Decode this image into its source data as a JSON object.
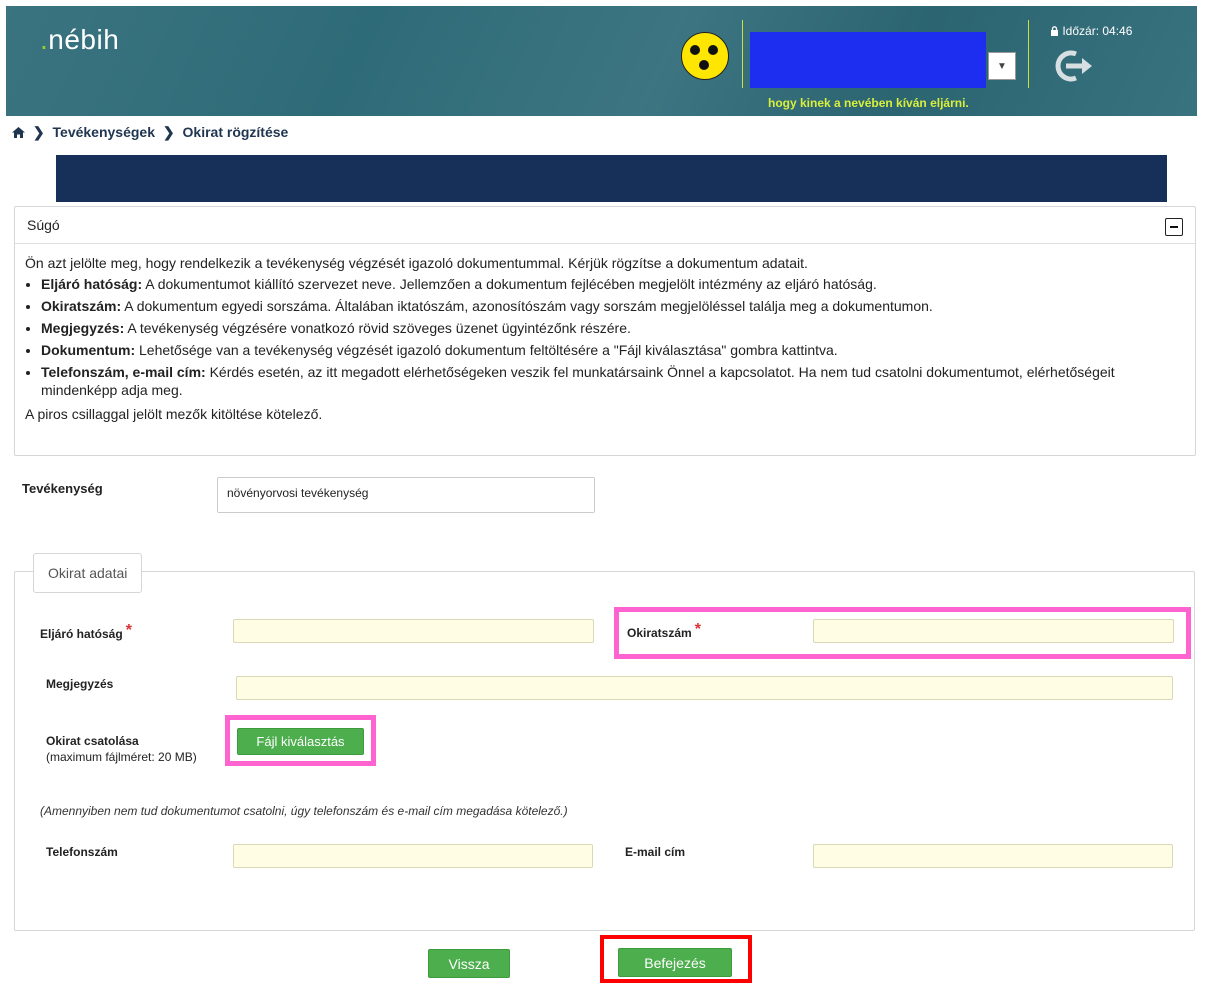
{
  "header": {
    "logo_dot": ".",
    "logo_text": "nébih",
    "rep_note": "hogy kinek a nevében kíván eljárni.",
    "timer_label": "Időzár: 04:46",
    "lock_icon": "lock-icon",
    "logout_icon": "logout-icon"
  },
  "breadcrumb": {
    "home_icon": "home-icon",
    "items": [
      "Tevékenységek",
      "Okirat rögzítése"
    ]
  },
  "help": {
    "title": "Súgó",
    "intro": "Ön azt jelölte meg, hogy rendelkezik a tevékenység végzését igazoló dokumentummal. Kérjük rögzítse a dokumentum adatait.",
    "items": [
      {
        "term": "Eljáró hatóság:",
        "text": " A dokumentumot kiállító szervezet neve. Jellemzően a dokumentum fejlécében megjelölt intézmény az eljáró hatóság."
      },
      {
        "term": "Okiratszám:",
        "text": " A dokumentum egyedi sorszáma. Általában iktatószám, azonosítószám vagy sorszám megjelöléssel találja meg a dokumentumon."
      },
      {
        "term": "Megjegyzés:",
        "text": " A tevékenység végzésére vonatkozó rövid szöveges üzenet ügyintézőnk részére."
      },
      {
        "term": "Dokumentum:",
        "text": " Lehetősége van a tevékenység végzését igazoló dokumentum feltöltésére a \"Fájl kiválasztása\" gombra kattintva."
      },
      {
        "term": "Telefonszám, e-mail cím:",
        "text": " Kérdés esetén, az itt megadott elérhetőségeken veszik fel munkatársaink Önnel a kapcsolatot. Ha nem tud csatolni dokumentumot, elérhetőségeit mindenképp adja meg."
      }
    ],
    "footer": "A piros csillaggal jelölt mezők kitöltése kötelező."
  },
  "activity": {
    "label": "Tevékenység",
    "value": "növényorvosi tevékenység"
  },
  "form": {
    "legend": "Okirat adatai",
    "required_mark": "*",
    "authority_label": "Eljáró hatóság",
    "authority_value": "",
    "doc_number_label": "Okiratszám",
    "doc_number_value": "",
    "comment_label": "Megjegyzés",
    "comment_value": "",
    "attach_label": "Okirat csatolása",
    "attach_sublabel": "(maximum fájlméret: 20 MB)",
    "file_button": "Fájl kiválasztás",
    "note": "(Amennyiben nem tud dokumentumot csatolni, úgy telefonszám és e-mail cím megadása kötelező.)",
    "phone_label": "Telefonszám",
    "phone_value": "",
    "email_label": "E-mail cím",
    "email_value": ""
  },
  "actions": {
    "back": "Vissza",
    "finish": "Befejezés"
  }
}
